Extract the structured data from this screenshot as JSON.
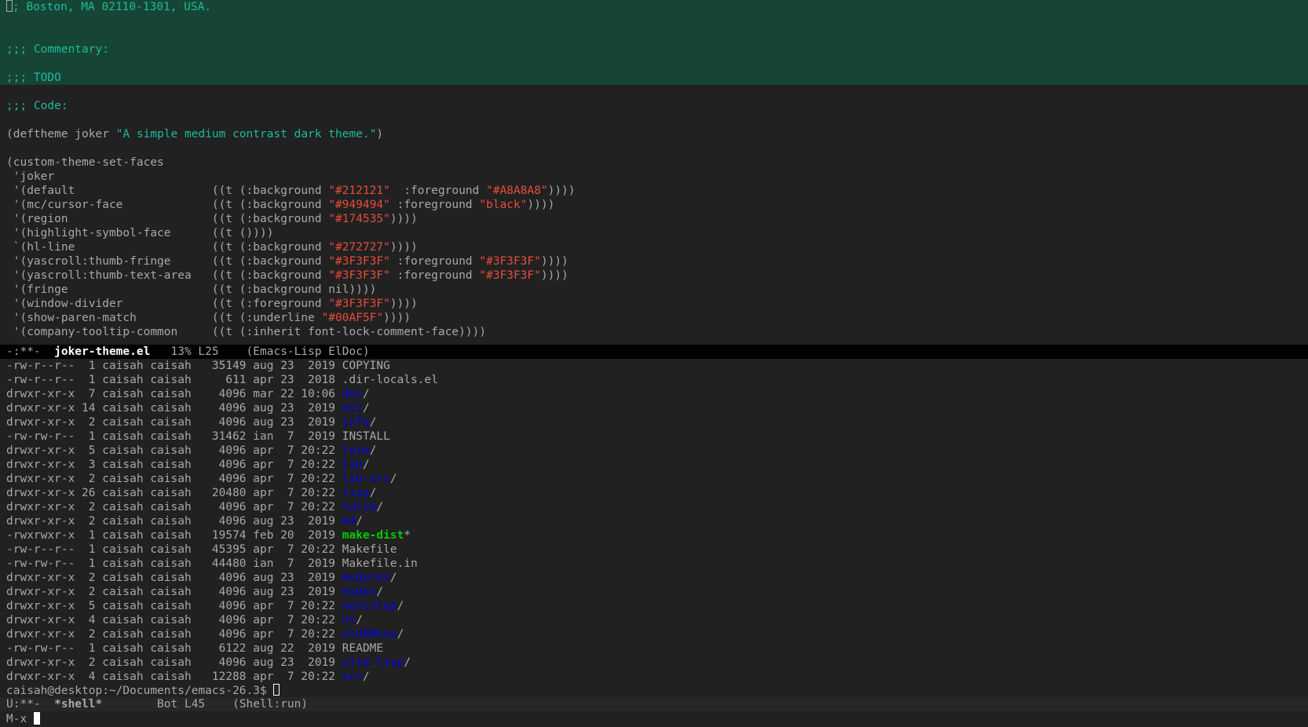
{
  "editor": {
    "region_lines": [
      {
        "text": "; Boston, MA 02110-1301, USA.",
        "cursor_prefix": true
      },
      {
        "text": ""
      },
      {
        "text": ""
      },
      {
        "text": ";;; Commentary:"
      },
      {
        "text": ""
      },
      {
        "text": ";;; TODO"
      }
    ],
    "after_lines": [
      {
        "segments": [
          {
            "t": ""
          }
        ]
      },
      {
        "segments": [
          {
            "t": ";;; Code:",
            "c": "comment"
          }
        ]
      },
      {
        "segments": [
          {
            "t": ""
          }
        ]
      },
      {
        "segments": [
          {
            "t": "(deftheme joker "
          },
          {
            "t": "\"A simple medium contrast dark theme.\"",
            "c": "comment"
          },
          {
            "t": ")"
          }
        ]
      },
      {
        "segments": [
          {
            "t": ""
          }
        ]
      },
      {
        "segments": [
          {
            "t": "(custom-theme-set-faces"
          }
        ]
      },
      {
        "segments": [
          {
            "t": " 'joker"
          }
        ]
      },
      {
        "segments": [
          {
            "t": " '(default                    ((t (:background "
          },
          {
            "t": "\"#212121\"",
            "c": "str"
          },
          {
            "t": "  :foreground "
          },
          {
            "t": "\"#A8A8A8\"",
            "c": "str"
          },
          {
            "t": "))))"
          }
        ]
      },
      {
        "segments": [
          {
            "t": " '(mc/cursor-face             ((t (:background "
          },
          {
            "t": "\"#949494\"",
            "c": "str"
          },
          {
            "t": " :foreground "
          },
          {
            "t": "\"black\"",
            "c": "str"
          },
          {
            "t": "))))"
          }
        ]
      },
      {
        "segments": [
          {
            "t": " '(region                     ((t (:background "
          },
          {
            "t": "\"#174535\"",
            "c": "str"
          },
          {
            "t": "))))"
          }
        ]
      },
      {
        "segments": [
          {
            "t": " '(highlight-symbol-face      ((t ())))"
          }
        ]
      },
      {
        "segments": [
          {
            "t": " `(hl-line                    ((t (:background "
          },
          {
            "t": "\"#272727\"",
            "c": "str"
          },
          {
            "t": "))))"
          }
        ]
      },
      {
        "segments": [
          {
            "t": " '(yascroll:thumb-fringe      ((t (:background "
          },
          {
            "t": "\"#3F3F3F\"",
            "c": "str"
          },
          {
            "t": " :foreground "
          },
          {
            "t": "\"#3F3F3F\"",
            "c": "str"
          },
          {
            "t": "))))"
          }
        ]
      },
      {
        "segments": [
          {
            "t": " '(yascroll:thumb-text-area   ((t (:background "
          },
          {
            "t": "\"#3F3F3F\"",
            "c": "str"
          },
          {
            "t": " :foreground "
          },
          {
            "t": "\"#3F3F3F\"",
            "c": "str"
          },
          {
            "t": "))))"
          }
        ]
      },
      {
        "segments": [
          {
            "t": " '(fringe                     ((t (:background nil))))"
          }
        ]
      },
      {
        "segments": [
          {
            "t": " '(window-divider             ((t (:foreground "
          },
          {
            "t": "\"#3F3F3F\"",
            "c": "str"
          },
          {
            "t": "))))"
          }
        ]
      },
      {
        "segments": [
          {
            "t": " '(show-paren-match           ((t (:underline "
          },
          {
            "t": "\"#00AF5F\"",
            "c": "str"
          },
          {
            "t": "))))"
          }
        ]
      },
      {
        "segments": [
          {
            "t": " '(company-tooltip-common     ((t (:inherit font-lock-comment-face))))"
          }
        ]
      }
    ]
  },
  "mode_line_editor": {
    "status": "-:**-  ",
    "buffer": "joker-theme.el",
    "position": "   13% L25    ",
    "modes": "(Emacs-Lisp ElDoc)"
  },
  "shell": {
    "listing": [
      {
        "perm": "-rw-r--r-- ",
        "links": " 1",
        "owner": "caisah",
        "group": "caisah",
        "size": "35149",
        "date": "aug 23  2019",
        "name": "COPYING",
        "kind": "file"
      },
      {
        "perm": "-rw-r--r-- ",
        "links": " 1",
        "owner": "caisah",
        "group": "caisah",
        "size": "  611",
        "date": "apr 23  2018",
        "name": ".dir-locals.el",
        "kind": "file"
      },
      {
        "perm": "drwxr-xr-x ",
        "links": " 7",
        "owner": "caisah",
        "group": "caisah",
        "size": " 4096",
        "date": "mar 22 10:06",
        "name": "doc",
        "kind": "dir"
      },
      {
        "perm": "drwxr-xr-x ",
        "links": "14",
        "owner": "caisah",
        "group": "caisah",
        "size": " 4096",
        "date": "aug 23  2019",
        "name": "etc",
        "kind": "dir"
      },
      {
        "perm": "drwxr-xr-x ",
        "links": " 2",
        "owner": "caisah",
        "group": "caisah",
        "size": " 4096",
        "date": "aug 23  2019",
        "name": "info",
        "kind": "dir"
      },
      {
        "perm": "-rw-rw-r-- ",
        "links": " 1",
        "owner": "caisah",
        "group": "caisah",
        "size": "31462",
        "date": "ian  7  2019",
        "name": "INSTALL",
        "kind": "file"
      },
      {
        "perm": "drwxr-xr-x ",
        "links": " 5",
        "owner": "caisah",
        "group": "caisah",
        "size": " 4096",
        "date": "apr  7 20:22",
        "name": "leim",
        "kind": "dir"
      },
      {
        "perm": "drwxr-xr-x ",
        "links": " 3",
        "owner": "caisah",
        "group": "caisah",
        "size": " 4096",
        "date": "apr  7 20:22",
        "name": "lib",
        "kind": "dir"
      },
      {
        "perm": "drwxr-xr-x ",
        "links": " 2",
        "owner": "caisah",
        "group": "caisah",
        "size": " 4096",
        "date": "apr  7 20:22",
        "name": "lib-src",
        "kind": "dir"
      },
      {
        "perm": "drwxr-xr-x ",
        "links": "26",
        "owner": "caisah",
        "group": "caisah",
        "size": "20480",
        "date": "apr  7 20:22",
        "name": "lisp",
        "kind": "dir"
      },
      {
        "perm": "drwxr-xr-x ",
        "links": " 2",
        "owner": "caisah",
        "group": "caisah",
        "size": " 4096",
        "date": "apr  7 20:22",
        "name": "lwlib",
        "kind": "dir"
      },
      {
        "perm": "drwxr-xr-x ",
        "links": " 2",
        "owner": "caisah",
        "group": "caisah",
        "size": " 4096",
        "date": "aug 23  2019",
        "name": "m4",
        "kind": "dir"
      },
      {
        "perm": "-rwxrwxr-x ",
        "links": " 1",
        "owner": "caisah",
        "group": "caisah",
        "size": "19574",
        "date": "feb 20  2019",
        "name": "make-dist",
        "kind": "exe"
      },
      {
        "perm": "-rw-r--r-- ",
        "links": " 1",
        "owner": "caisah",
        "group": "caisah",
        "size": "45395",
        "date": "apr  7 20:22",
        "name": "Makefile",
        "kind": "file"
      },
      {
        "perm": "-rw-rw-r-- ",
        "links": " 1",
        "owner": "caisah",
        "group": "caisah",
        "size": "44480",
        "date": "ian  7  2019",
        "name": "Makefile.in",
        "kind": "file"
      },
      {
        "perm": "drwxr-xr-x ",
        "links": " 2",
        "owner": "caisah",
        "group": "caisah",
        "size": " 4096",
        "date": "aug 23  2019",
        "name": "modules",
        "kind": "dir"
      },
      {
        "perm": "drwxr-xr-x ",
        "links": " 2",
        "owner": "caisah",
        "group": "caisah",
        "size": " 4096",
        "date": "aug 23  2019",
        "name": "msdos",
        "kind": "dir"
      },
      {
        "perm": "drwxr-xr-x ",
        "links": " 5",
        "owner": "caisah",
        "group": "caisah",
        "size": " 4096",
        "date": "apr  7 20:22",
        "name": "nextstep",
        "kind": "dir"
      },
      {
        "perm": "drwxr-xr-x ",
        "links": " 4",
        "owner": "caisah",
        "group": "caisah",
        "size": " 4096",
        "date": "apr  7 20:22",
        "name": "nt",
        "kind": "dir"
      },
      {
        "perm": "drwxr-xr-x ",
        "links": " 2",
        "owner": "caisah",
        "group": "caisah",
        "size": " 4096",
        "date": "apr  7 20:22",
        "name": "oldXMenu",
        "kind": "dir"
      },
      {
        "perm": "-rw-rw-r-- ",
        "links": " 1",
        "owner": "caisah",
        "group": "caisah",
        "size": " 6122",
        "date": "aug 22  2019",
        "name": "README",
        "kind": "file"
      },
      {
        "perm": "drwxr-xr-x ",
        "links": " 2",
        "owner": "caisah",
        "group": "caisah",
        "size": " 4096",
        "date": "aug 23  2019",
        "name": "site-lisp",
        "kind": "dir"
      },
      {
        "perm": "drwxr-xr-x ",
        "links": " 4",
        "owner": "caisah",
        "group": "caisah",
        "size": "12288",
        "date": "apr  7 20:22",
        "name": "src",
        "kind": "dir"
      }
    ],
    "prompt": "caisah@desktop:~/Documents/emacs-26.3$ "
  },
  "mode_line_shell": {
    "status": "U:**-  ",
    "buffer": "*shell*",
    "position": "        Bot L45    ",
    "modes": "(Shell:run)"
  },
  "minibuffer": {
    "prompt": "M-x "
  },
  "colors": {
    "background": "#212121",
    "foreground": "#A8A8A8",
    "region": "#174535",
    "comment": "#1ABC9C",
    "string": "#E74C3C",
    "directory": "#0000EE",
    "executable": "#00CD00"
  }
}
